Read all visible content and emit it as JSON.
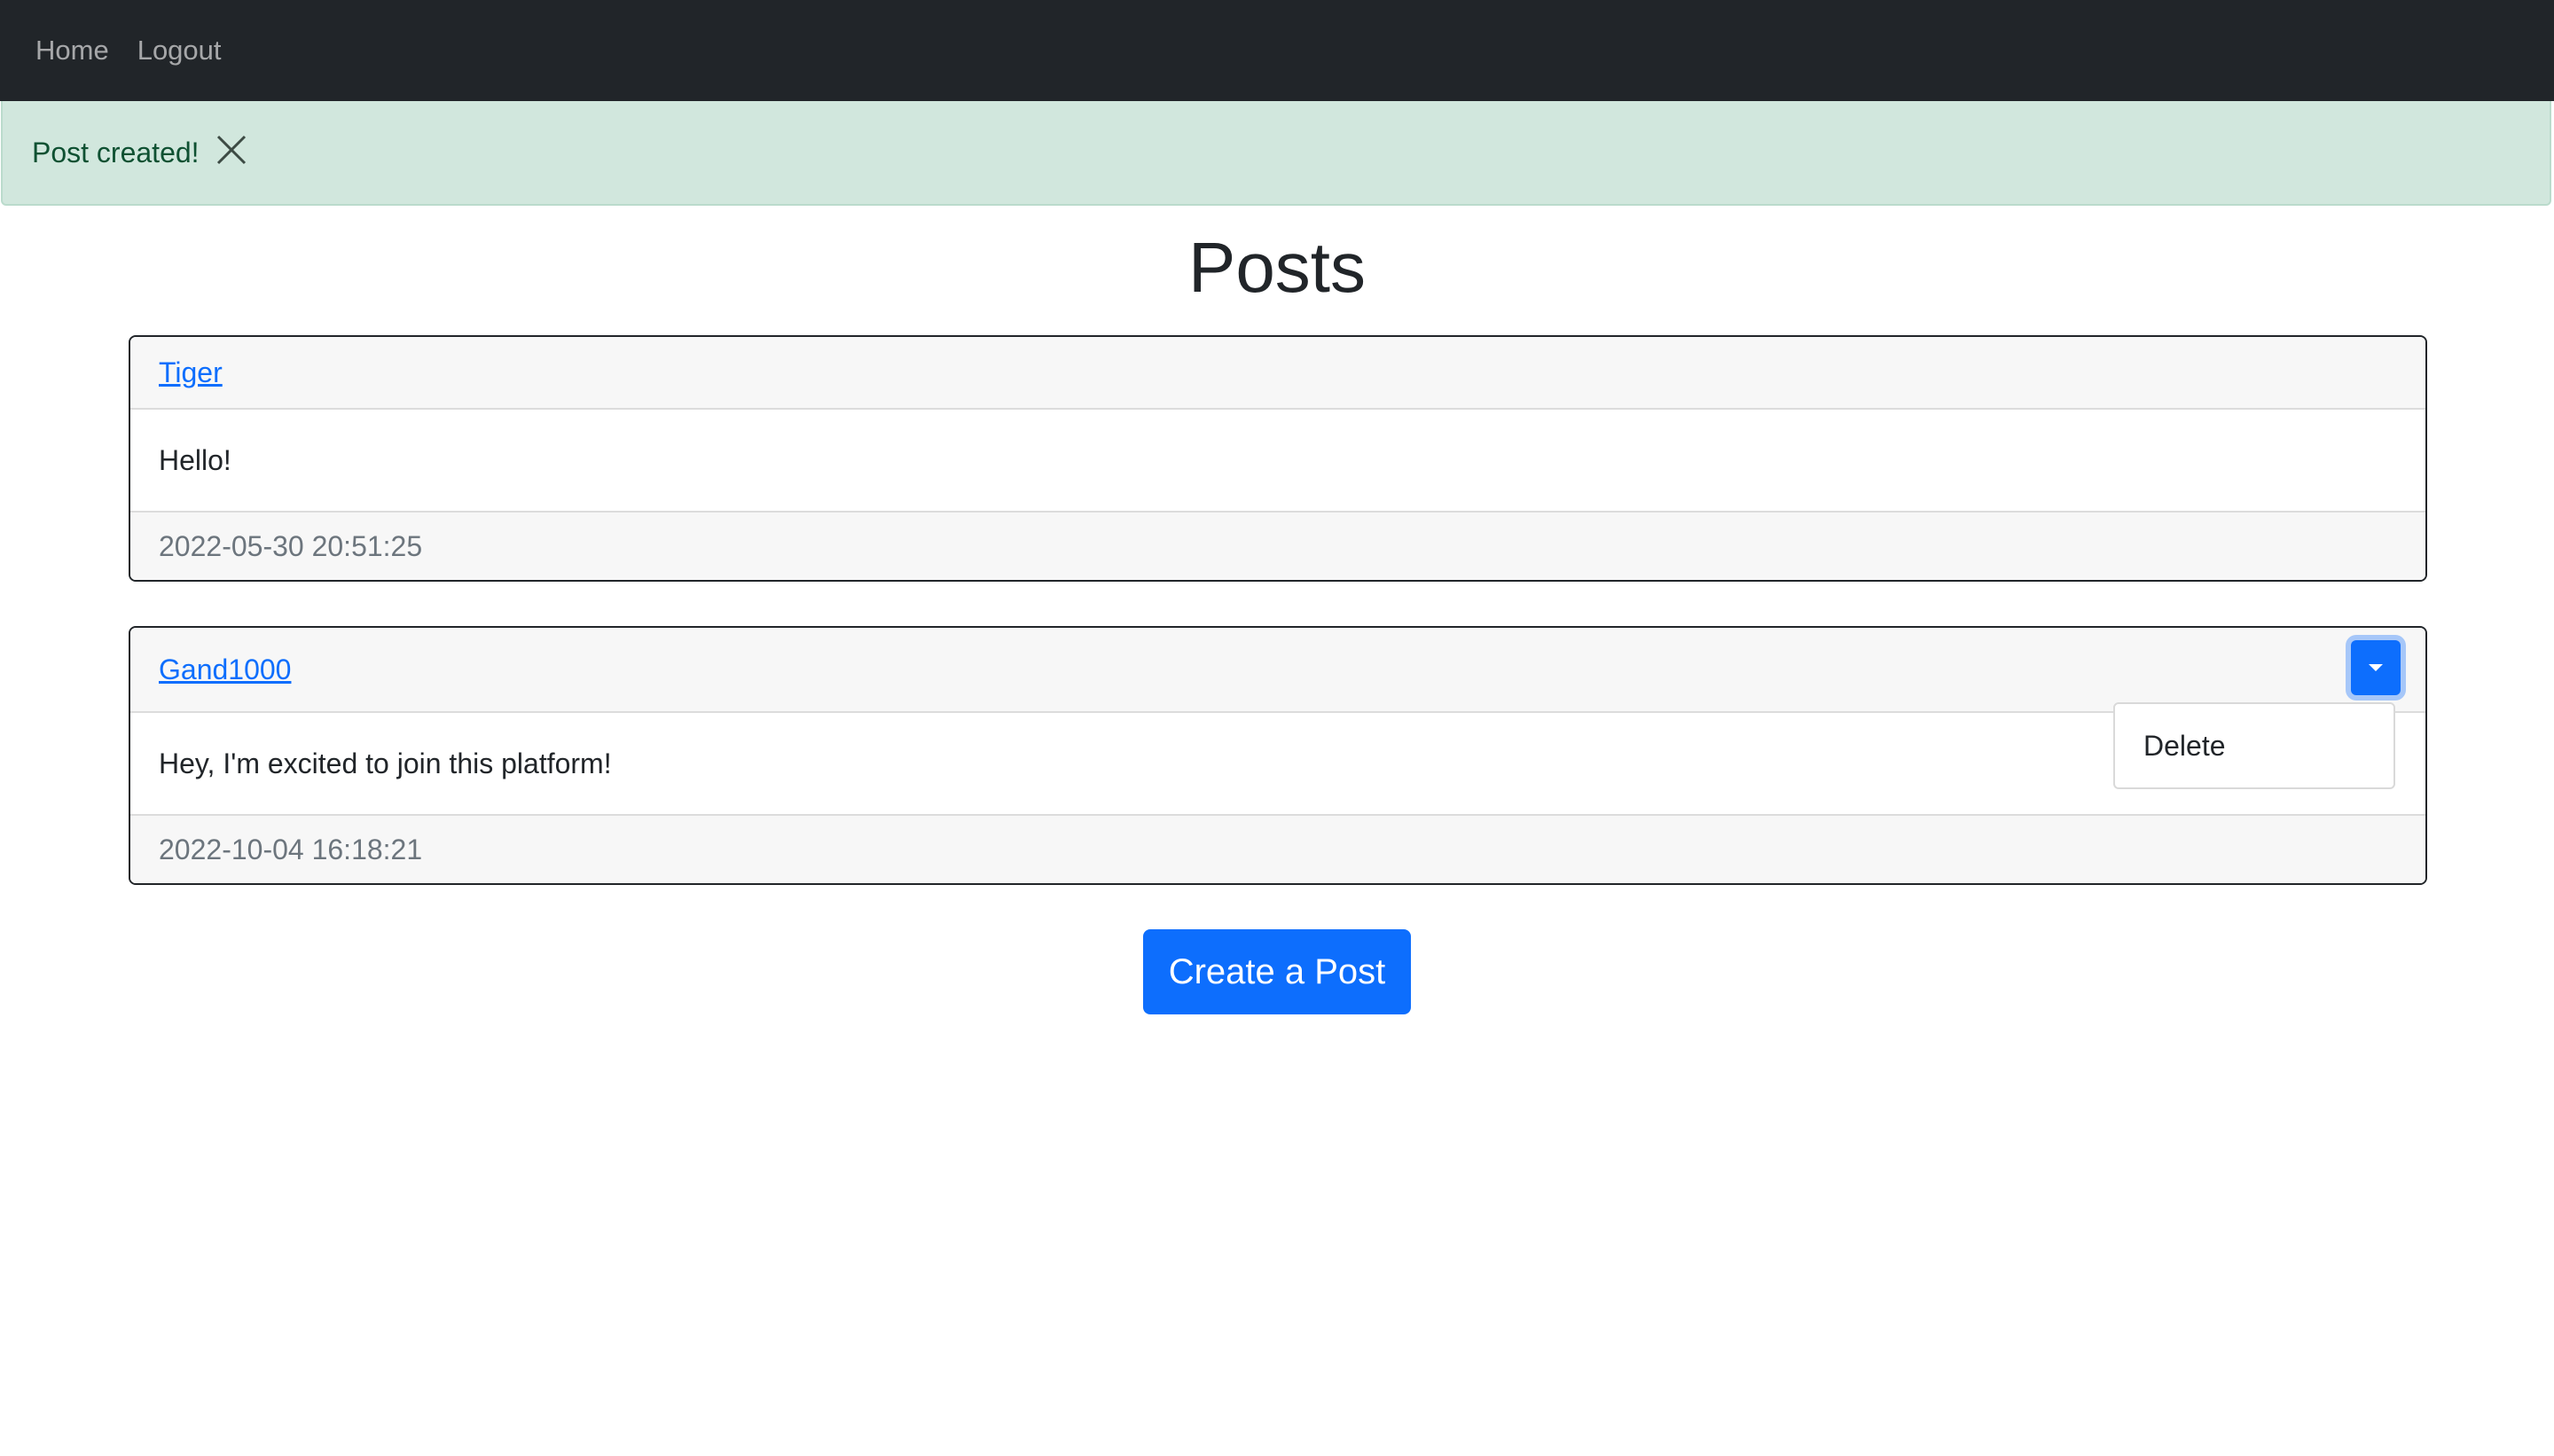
{
  "nav": {
    "home_label": "Home",
    "logout_label": "Logout"
  },
  "alert": {
    "message": "Post created!",
    "close_icon": "close-x-icon",
    "color": "#d1e7dd"
  },
  "page": {
    "title": "Posts"
  },
  "posts": [
    {
      "author": "Tiger",
      "content": "Hello!",
      "timestamp": "2022-05-30 20:51:25"
    },
    {
      "author": "Gand1000",
      "content": "Hey, I'm excited to join this platform!",
      "timestamp": "2022-10-04 16:18:21",
      "menu": {
        "toggle_icon": "caret-down-icon",
        "items": [
          "Delete"
        ]
      }
    }
  ],
  "actions": {
    "create_post_label": "Create a Post"
  },
  "colors": {
    "navbar": "#212529",
    "primary": "#0d6efd",
    "alert_text": "#0f5132"
  }
}
